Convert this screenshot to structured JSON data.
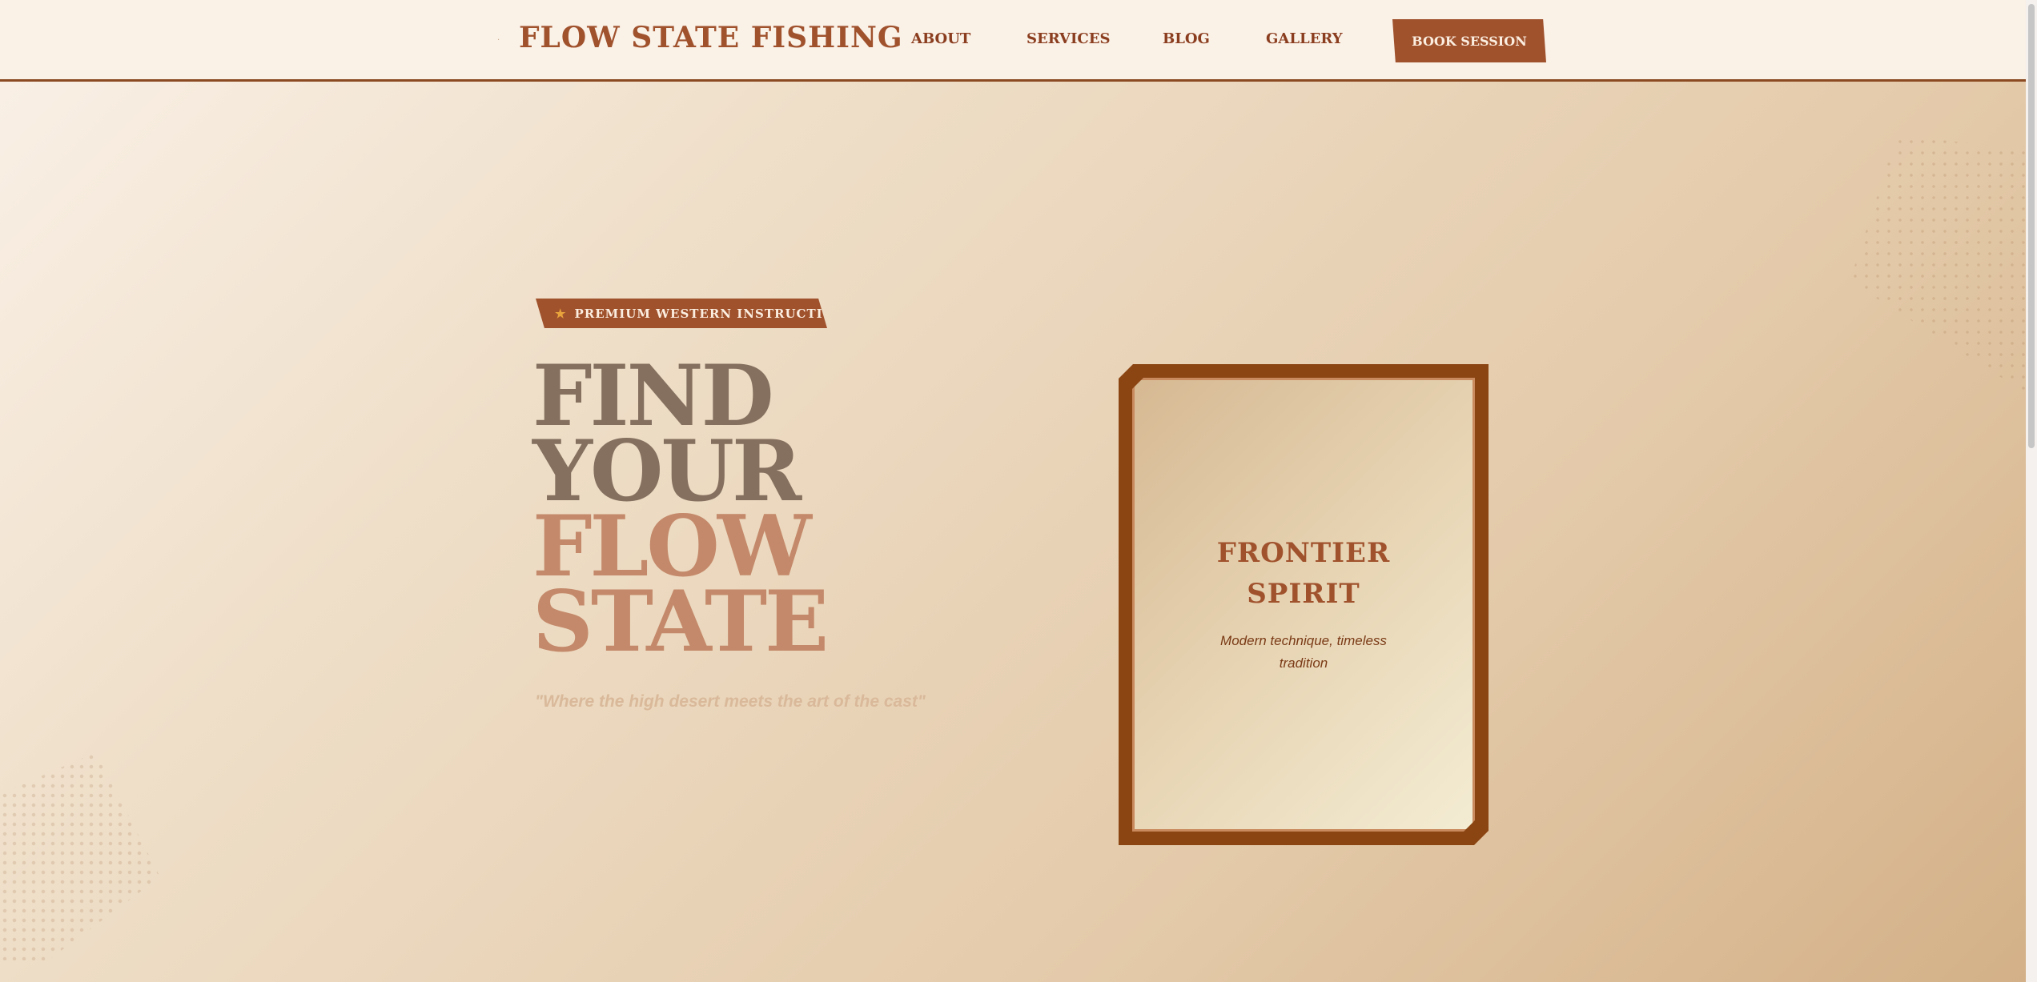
{
  "header": {
    "brand_dot": "·",
    "brand": "FLOW STATE FISHING",
    "nav": [
      "ABOUT",
      "SERVICES",
      "BLOG",
      "GALLERY"
    ],
    "cta_label": "BOOK SESSION"
  },
  "hero": {
    "tag_icon": "star-icon",
    "tag_star": "★",
    "tag_label": "PREMIUM WESTERN INSTRUCTION",
    "headline": [
      "FIND",
      "YOUR",
      "FLOW",
      "STATE"
    ],
    "quote": "\"Where the high desert meets the art of the cast\""
  },
  "card": {
    "title_line1": "FRONTIER",
    "title_line2": "SPIRIT",
    "subtitle_line1": "Modern technique, timeless",
    "subtitle_line2": "tradition"
  },
  "colors": {
    "brand": "#a0522d",
    "frame": "#8b4513",
    "headline_dark": "#85705f",
    "headline_light": "#c4896a"
  }
}
